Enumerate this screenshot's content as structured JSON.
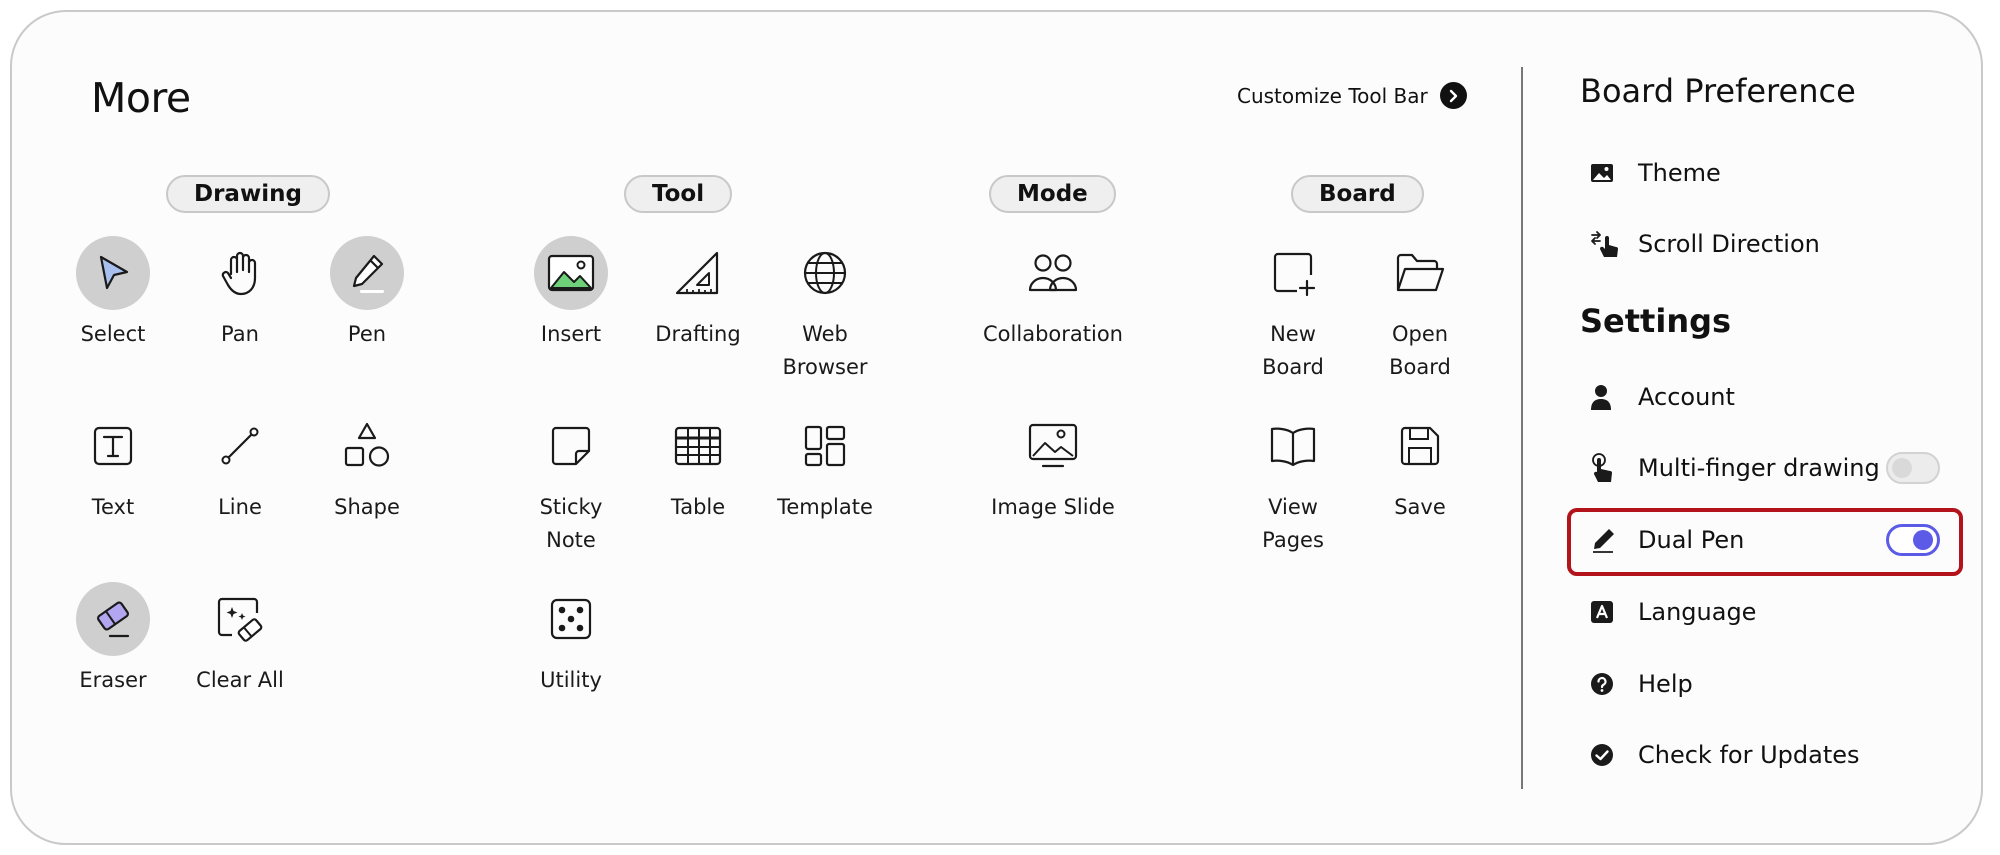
{
  "header": {
    "title": "More",
    "customize_label": "Customize Tool Bar"
  },
  "categories": {
    "drawing": "Drawing",
    "tool": "Tool",
    "mode": "Mode",
    "board": "Board"
  },
  "tools": {
    "select": "Select",
    "pan": "Pan",
    "pen": "Pen",
    "text": "Text",
    "line": "Line",
    "shape": "Shape",
    "eraser": "Eraser",
    "clear_all": "Clear All",
    "insert": "Insert",
    "drafting": "Drafting",
    "web_browser": "Web\nBrowser",
    "sticky_note": "Sticky\nNote",
    "table": "Table",
    "template": "Template",
    "utility": "Utility",
    "collaboration": "Collaboration",
    "image_slide": "Image Slide",
    "new_board": "New\nBoard",
    "open_board": "Open\nBoard",
    "view_pages": "View\nPages",
    "save": "Save"
  },
  "sidebar": {
    "board_preference_title": "Board Preference",
    "theme": "Theme",
    "scroll_direction": "Scroll Direction",
    "settings_title": "Settings",
    "account": "Account",
    "multi_finger_drawing": "Multi-finger drawing",
    "multi_finger_drawing_on": false,
    "dual_pen": "Dual Pen",
    "dual_pen_on": true,
    "language": "Language",
    "help": "Help",
    "check_updates": "Check for Updates"
  },
  "colors": {
    "toggle_accent": "#5b5be8",
    "highlight": "#b3131b",
    "active_tool_bg": "#cfcfcf"
  }
}
